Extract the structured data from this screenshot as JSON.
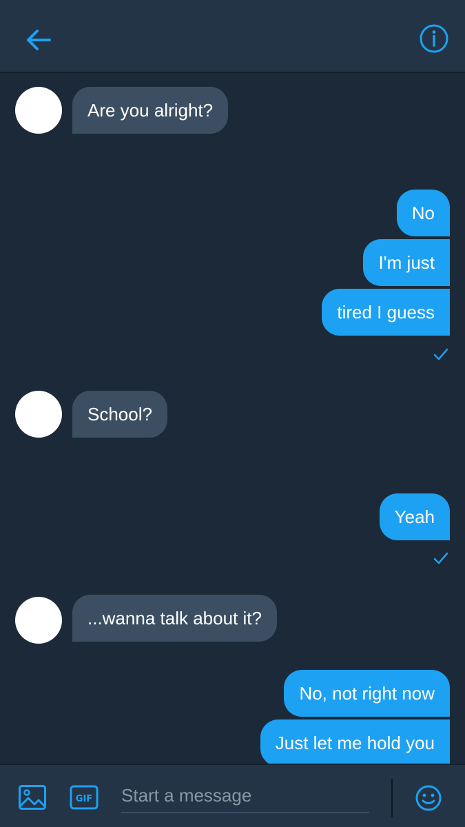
{
  "header": {
    "back_icon": "arrow-left-icon",
    "info_icon": "info-circle-icon",
    "accent_color": "#1da1f2"
  },
  "messages": [
    {
      "direction": "incoming",
      "text": "Are you alright?"
    },
    {
      "direction": "outgoing",
      "text": "No"
    },
    {
      "direction": "outgoing",
      "text": "I'm just"
    },
    {
      "direction": "outgoing",
      "text": "tired I guess",
      "status": "read-check"
    },
    {
      "direction": "incoming",
      "text": "School?"
    },
    {
      "direction": "outgoing",
      "text": "Yeah",
      "status": "read-check"
    },
    {
      "direction": "incoming",
      "text": "...wanna talk about it?"
    },
    {
      "direction": "outgoing",
      "text": "No, not right now"
    },
    {
      "direction": "outgoing",
      "text": "Just let me hold you"
    }
  ],
  "composer": {
    "placeholder": "Start a message",
    "gif_label": "GIF",
    "media_icon": "image-icon",
    "emoji_icon": "emoji-smile-icon"
  },
  "colors": {
    "background": "#1c2938",
    "bar": "#243447",
    "incoming_bubble": "#3c4f62",
    "outgoing_bubble": "#1da1f2"
  }
}
